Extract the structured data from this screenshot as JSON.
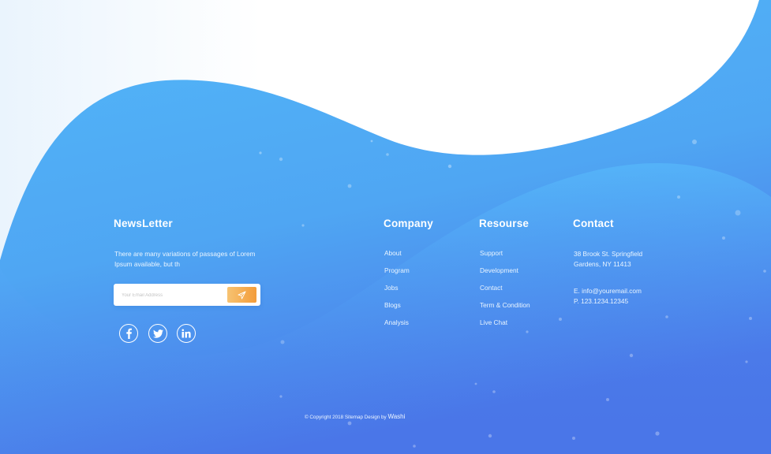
{
  "colors": {
    "wave_top": "#52B5F7",
    "wave_bottom": "#4A78E8",
    "accent_button": "#F5A84E",
    "text": "#FFFFFF"
  },
  "newsletter": {
    "title": "NewsLetter",
    "description": "There are many variations of passages of Lorem Ipsum available, but th",
    "input_placeholder": "Your Email Address",
    "submit_icon": "paper-plane-icon"
  },
  "social": [
    {
      "icon": "facebook-icon"
    },
    {
      "icon": "twitter-icon"
    },
    {
      "icon": "linkedin-icon"
    }
  ],
  "company": {
    "title": "Company",
    "links": [
      "About",
      "Program",
      "Jobs",
      "Blogs",
      "Analysis"
    ]
  },
  "resource": {
    "title": "Resourse",
    "links": [
      "Support",
      "Development",
      "Contact",
      "Term & Condition",
      "Live Chat"
    ]
  },
  "contact": {
    "title": "Contact",
    "address_line1": "38 Brook St. Springfield",
    "address_line2": "Gardens, NY 11413",
    "email": "E. info@youremail.com",
    "phone": "P. 123.1234.12345"
  },
  "copyright": {
    "text": "© Copyright 2018 Sitemap Design by",
    "brand": "Washi"
  }
}
